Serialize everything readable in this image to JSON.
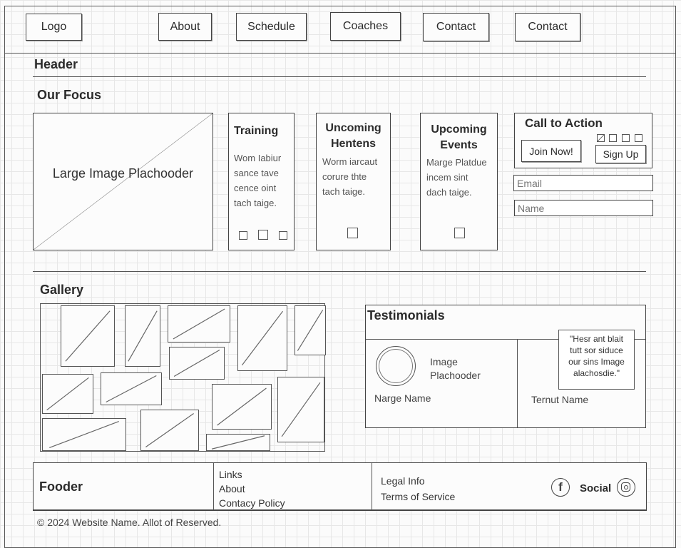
{
  "nav": {
    "logo": "Logo",
    "items": [
      "About",
      "Schedule",
      "Coaches",
      "Contact",
      "Contact"
    ]
  },
  "header": {
    "title": "Header"
  },
  "focus": {
    "title": "Our Focus",
    "image_label": "Large Image Plachooder",
    "cards": [
      {
        "title": "Training",
        "text": [
          "Wom Iabiur",
          "sance tave",
          "cence oint",
          "tach taige."
        ]
      },
      {
        "title": "Uncoming Hentens",
        "text": [
          "Worm iarcaut",
          "corure thte",
          "tach taige."
        ]
      },
      {
        "title": "Upcoming Events",
        "text": [
          "Marge Platdue",
          "incem sint",
          "dach taige."
        ]
      }
    ]
  },
  "cta": {
    "title": "Call to Action",
    "join_label": "Join Now!",
    "signup_label": "Sign Up",
    "email_placeholder": "Email",
    "name_placeholder": "Name"
  },
  "gallery": {
    "title": "Gallery"
  },
  "testimonials": {
    "title": "Testimonials",
    "left": {
      "image_label_1": "Image",
      "image_label_2": "Plachooder",
      "name": "Narge Name"
    },
    "right": {
      "quote_lines": [
        "\"Hesr ant blait",
        "tutt sor siduce",
        "our sins Image",
        "alachosdie.\""
      ],
      "name": "Ternut Name"
    }
  },
  "footer": {
    "title": "Fooder",
    "links_title": "Links",
    "links": [
      "About",
      "Contacy Policy"
    ],
    "legal_title": "Legal Info",
    "legal_link": "Terms of Service",
    "social_label": "Social",
    "copyright": "© 2024 Website Name. Allot of Reserved."
  }
}
